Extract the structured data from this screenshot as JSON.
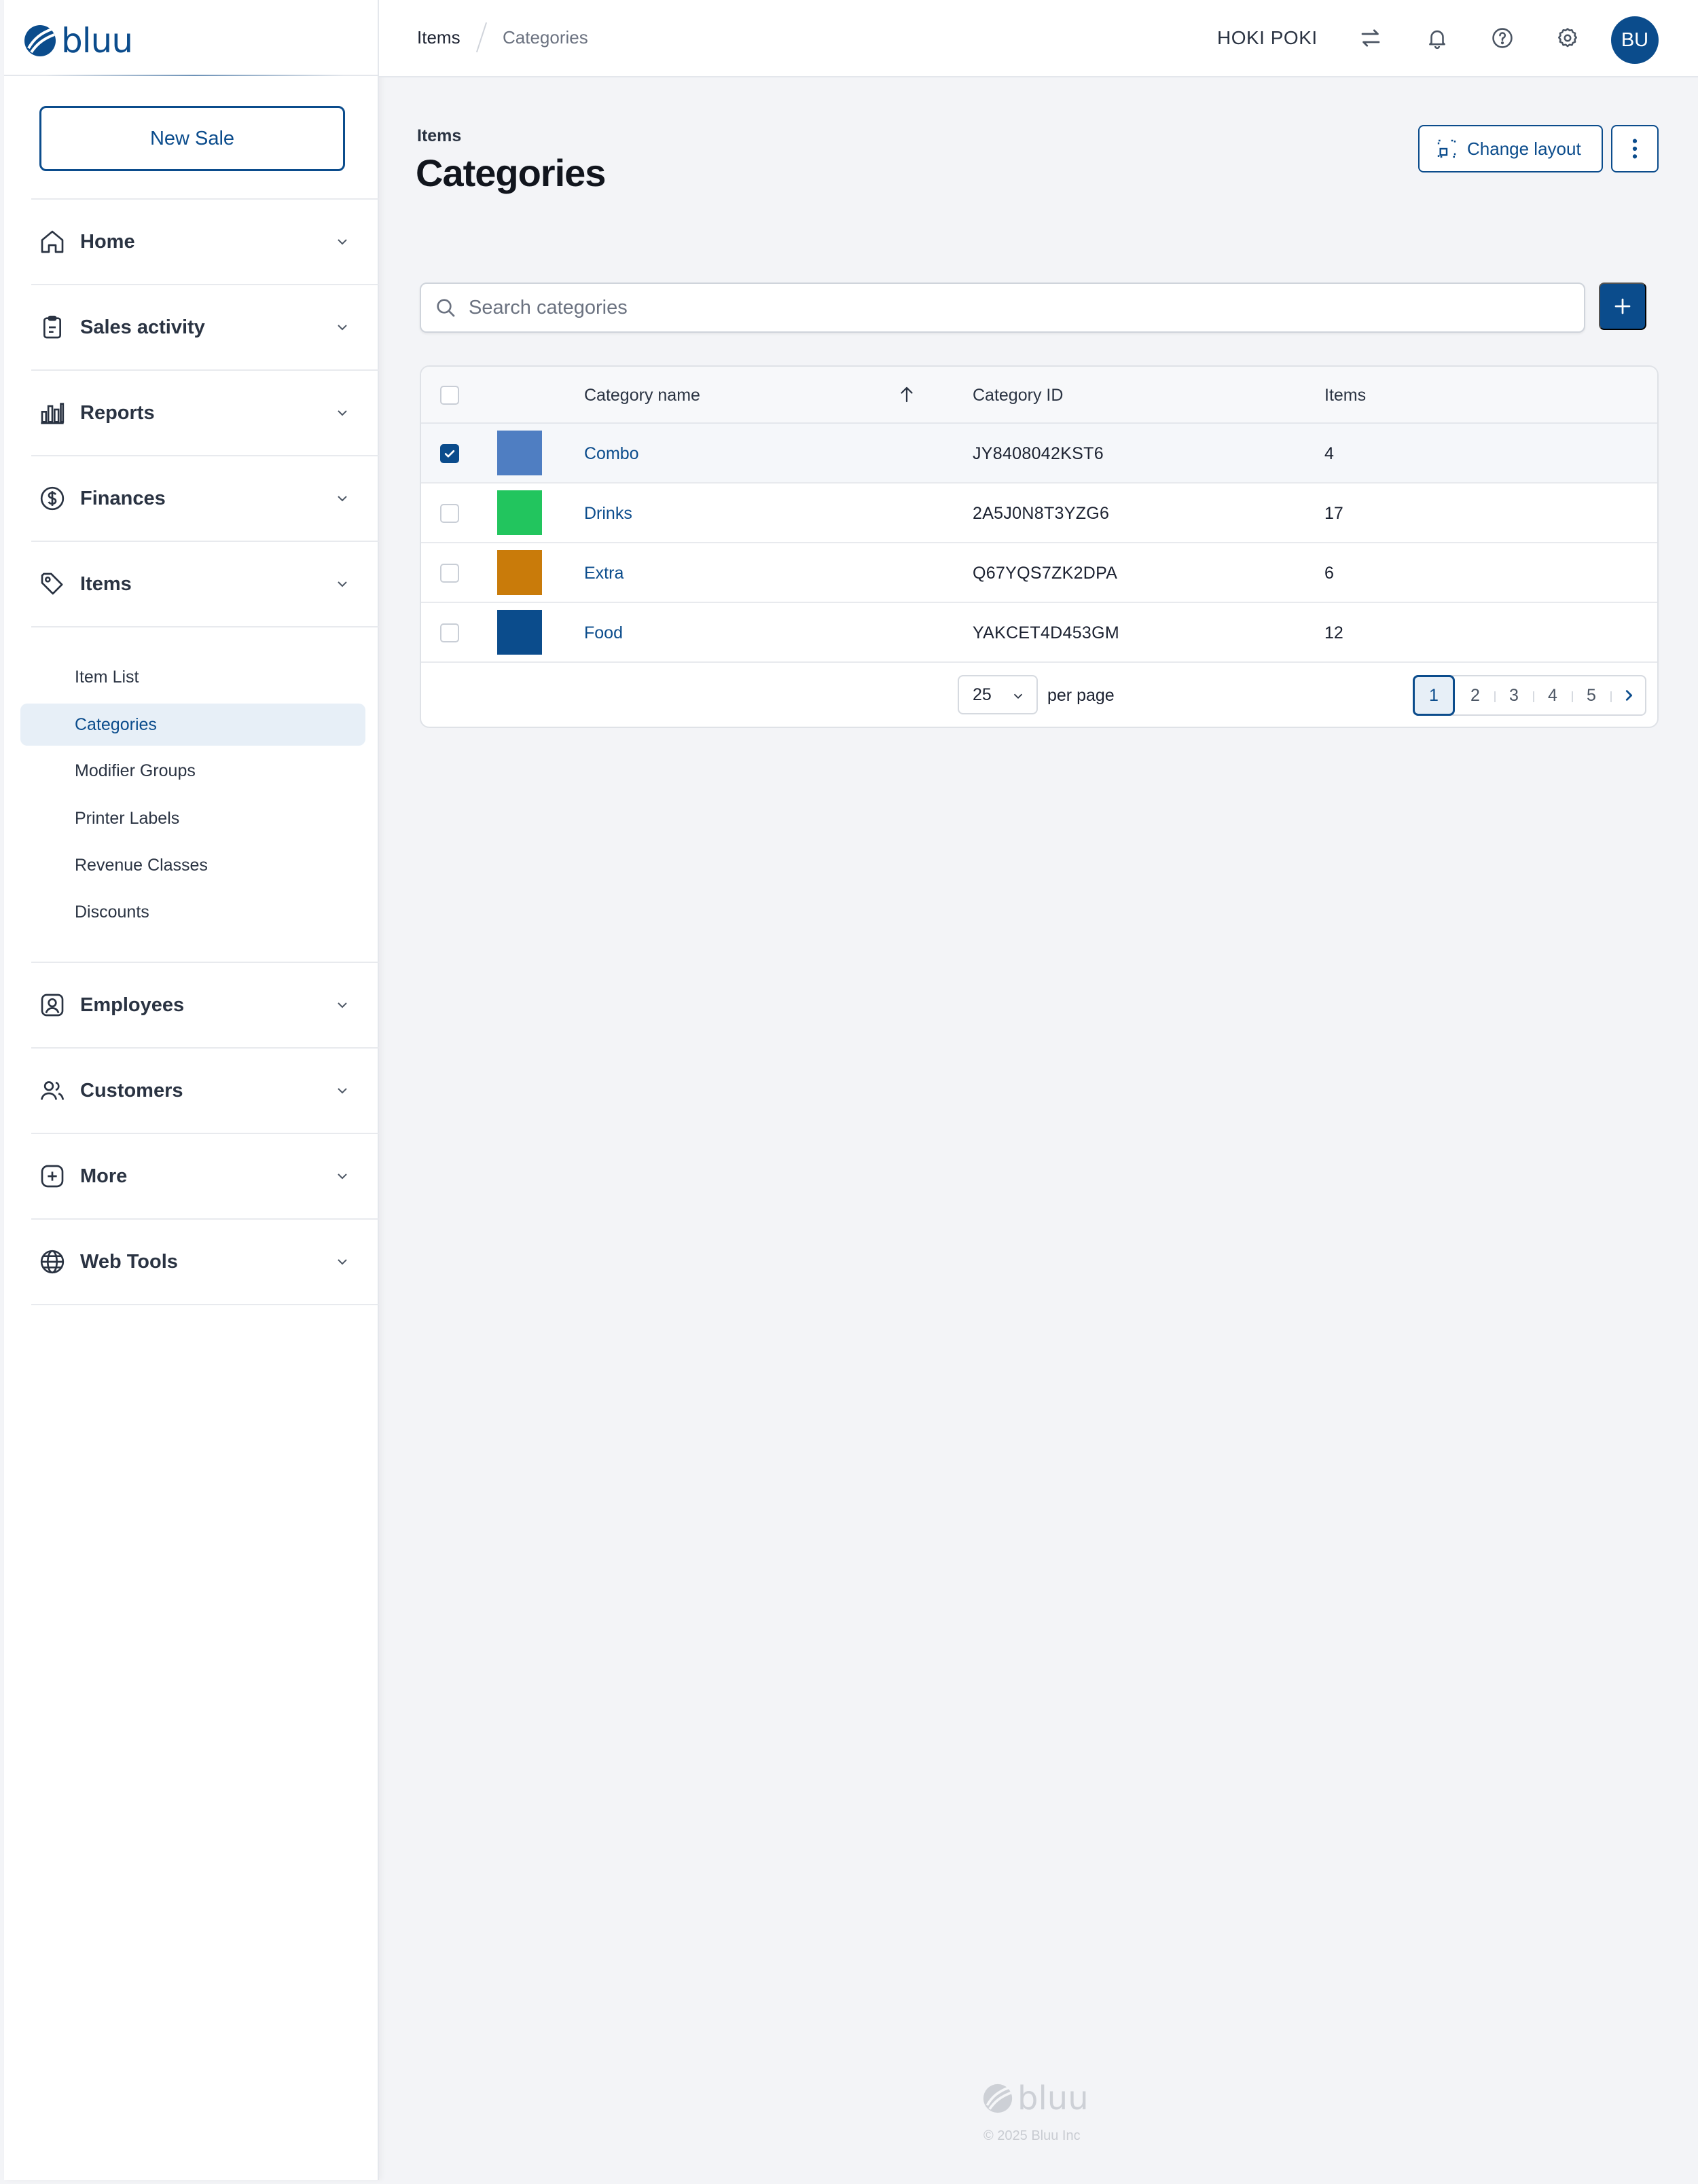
{
  "brand": {
    "name": "bluu",
    "color": "#0b4c8c"
  },
  "sidebar": {
    "new_sale_label": "New Sale",
    "nav": [
      {
        "label": "Home",
        "icon": "home-icon"
      },
      {
        "label": "Sales activity",
        "icon": "clipboard-icon"
      },
      {
        "label": "Reports",
        "icon": "bar-chart-icon"
      },
      {
        "label": "Finances",
        "icon": "dollar-circle-icon"
      },
      {
        "label": "Items",
        "icon": "tag-icon"
      },
      {
        "label": "Employees",
        "icon": "id-badge-icon"
      },
      {
        "label": "Customers",
        "icon": "users-icon"
      },
      {
        "label": "More",
        "icon": "plus-square-icon"
      },
      {
        "label": "Web Tools",
        "icon": "globe-icon"
      }
    ],
    "items_sub": [
      "Item List",
      "Categories",
      "Modifier Groups",
      "Printer Labels",
      "Revenue Classes",
      "Discounts"
    ],
    "active_sub": "Categories"
  },
  "topbar": {
    "breadcrumb": [
      "Items",
      "Categories"
    ],
    "store_name": "HOKI POKI",
    "icons": [
      "swap-arrows-icon",
      "bell-icon",
      "help-circle-icon",
      "gear-icon"
    ],
    "avatar_initials": "BU"
  },
  "header": {
    "eyebrow": "Items",
    "title": "Categories",
    "change_layout_label": "Change layout"
  },
  "search": {
    "placeholder": "Search categories"
  },
  "table": {
    "columns": {
      "name": "Category name",
      "id": "Category ID",
      "items": "Items"
    },
    "rows": [
      {
        "name": "Combo",
        "id": "JY8408042KST6",
        "items": "4",
        "color": "#4f7ec2",
        "checked": true
      },
      {
        "name": "Drinks",
        "id": "2A5J0N8T3YZG6",
        "items": "17",
        "color": "#22c55e",
        "checked": false
      },
      {
        "name": "Extra",
        "id": "Q67YQS7ZK2DPA",
        "items": "6",
        "color": "#c97b0a",
        "checked": false
      },
      {
        "name": "Food",
        "id": "YAKCET4D453GM",
        "items": "12",
        "color": "#0b4c8c",
        "checked": false
      }
    ],
    "per_page": "25",
    "per_page_label": "per page",
    "pages": [
      "1",
      "2",
      "3",
      "4",
      "5"
    ],
    "current_page": "1"
  },
  "footer": {
    "brand": "bluu",
    "copyright": "© 2025 Bluu Inc"
  }
}
